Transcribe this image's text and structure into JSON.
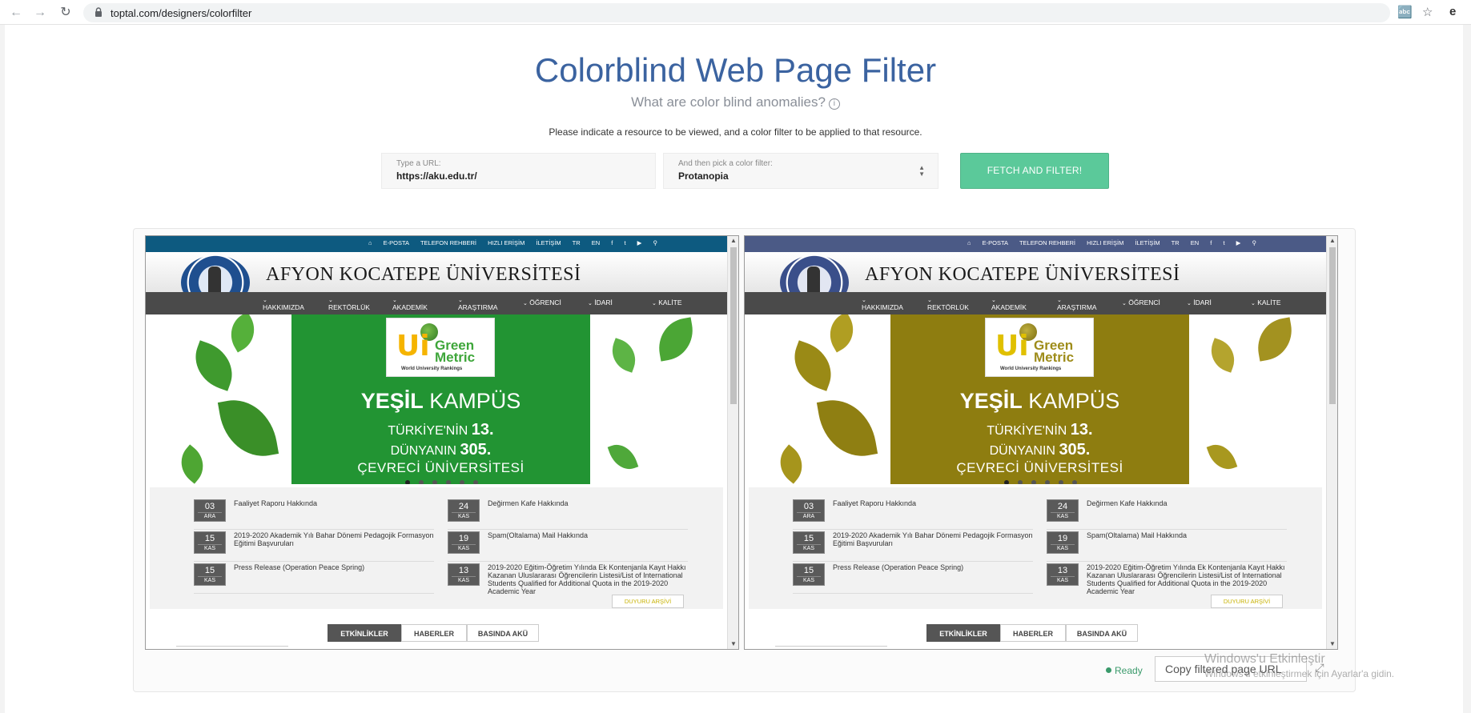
{
  "browser": {
    "url": "toptal.com/designers/colorfilter"
  },
  "header": {
    "title": "Colorblind Web Page Filter",
    "subtitle": "What are color blind anomalies?",
    "instruction": "Please indicate a resource to be viewed, and a color filter to be applied to that resource."
  },
  "form": {
    "url_label": "Type a URL:",
    "url_value": "https://aku.edu.tr/",
    "filter_label": "And then pick a color filter:",
    "filter_value": "Protanopia",
    "submit_label": "FETCH AND FILTER!"
  },
  "site": {
    "topbar_links": [
      "E-POSTA",
      "TELEFON REHBERİ",
      "HIZLI ERİŞİM",
      "İLETİŞİM",
      "TR",
      "EN"
    ],
    "name": "AFYON KOCATEPE ÜNİVERSİTESİ",
    "nav": [
      "HAKKIMIZDA",
      "REKTÖRLÜK",
      "AKADEMİK",
      "ARAŞTIRMA",
      "ÖĞRENCİ",
      "İDARİ",
      "KALİTE"
    ],
    "hero": {
      "badge_main": "Green Metric",
      "badge_ui": "Ui",
      "badge_sub": "World University Rankings",
      "line1_bold": "YEŞİL",
      "line1_rest": "KAMPÜS",
      "line2_a": "TÜRKİYE'NİN",
      "line2_b": "13.",
      "line3_a": "DÜNYANIN",
      "line3_b": "305.",
      "line4": "ÇEVRECİ ÜNİVERSİTESİ"
    },
    "news": [
      {
        "day": "03",
        "month": "ARA",
        "text": "Faaliyet Raporu Hakkında"
      },
      {
        "day": "15",
        "month": "KAS",
        "text": "2019-2020 Akademik Yılı Bahar Dönemi Pedagojik Formasyon Eğitimi Başvuruları"
      },
      {
        "day": "15",
        "month": "KAS",
        "text": "Press Release (Operation Peace Spring)"
      },
      {
        "day": "24",
        "month": "KAS",
        "text": "Değirmen Kafe Hakkında"
      },
      {
        "day": "19",
        "month": "KAS",
        "text": "Spam(Oltalama) Mail Hakkında"
      },
      {
        "day": "13",
        "month": "KAS",
        "text": "2019-2020 Eğitim-Öğretim Yılında Ek Kontenjanla Kayıt Hakkı Kazanan Uluslararası Öğrencilerin Listesi/List of International Students Qualified for Additional Quota in the 2019-2020 Academic Year"
      }
    ],
    "archive_button": "DUYURU ARŞİVİ",
    "tabs": [
      "ETKİNLİKLER",
      "HABERLER",
      "BASINDA AKÜ"
    ]
  },
  "status": {
    "ready": "Ready",
    "copy_button": "Copy filtered page URL"
  },
  "watermark": {
    "line1": "Windows'u Etkinleştir",
    "line2": "Windows'u etkinleştirmek için Ayarlar'a gidin."
  },
  "colors": {
    "title_blue": "#3b63a0",
    "button_green": "#5bc99a",
    "original_hero": "#229433",
    "filtered_hero": "#8e7d10",
    "original_topbar": "#0d5a80",
    "filtered_topbar": "#4b5a86"
  }
}
